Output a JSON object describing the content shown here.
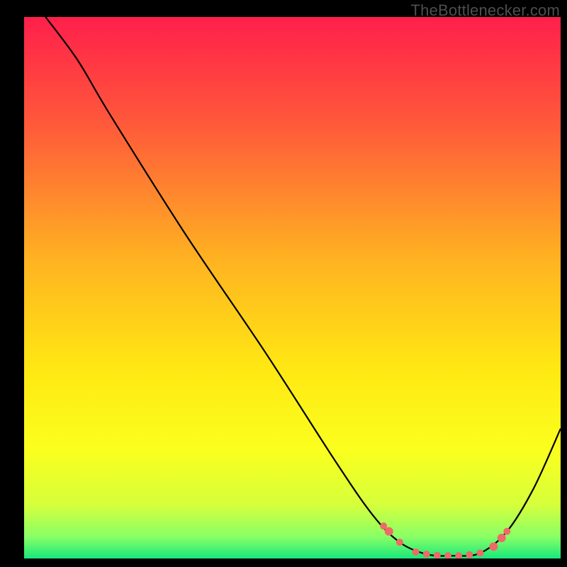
{
  "watermark": "TheBottlenecker.com",
  "chart_data": {
    "type": "line",
    "title": "",
    "xlabel": "",
    "ylabel": "",
    "xlim": [
      0,
      100
    ],
    "ylim": [
      0,
      100
    ],
    "background_gradient": {
      "stops": [
        {
          "pct": 0,
          "color": "#ff1f4b"
        },
        {
          "pct": 20,
          "color": "#ff5a3a"
        },
        {
          "pct": 45,
          "color": "#ffb321"
        },
        {
          "pct": 65,
          "color": "#ffe813"
        },
        {
          "pct": 80,
          "color": "#fbff1e"
        },
        {
          "pct": 90,
          "color": "#d6ff3b"
        },
        {
          "pct": 96,
          "color": "#89ff66"
        },
        {
          "pct": 100,
          "color": "#17e87b"
        }
      ]
    },
    "curve": {
      "stroke": "#000000",
      "stroke_width": 2.2,
      "points": [
        {
          "x": 4,
          "y": 100
        },
        {
          "x": 10,
          "y": 92
        },
        {
          "x": 16,
          "y": 82
        },
        {
          "x": 30,
          "y": 60
        },
        {
          "x": 45,
          "y": 38
        },
        {
          "x": 58,
          "y": 18
        },
        {
          "x": 65,
          "y": 8
        },
        {
          "x": 70,
          "y": 3
        },
        {
          "x": 75,
          "y": 0.8
        },
        {
          "x": 80,
          "y": 0.5
        },
        {
          "x": 85,
          "y": 1
        },
        {
          "x": 90,
          "y": 5
        },
        {
          "x": 95,
          "y": 13
        },
        {
          "x": 100,
          "y": 24
        }
      ]
    },
    "markers": {
      "color": "#ee6a66",
      "points": [
        {
          "x": 67,
          "y": 6.0,
          "r": 5
        },
        {
          "x": 68,
          "y": 5.0,
          "r": 6
        },
        {
          "x": 70,
          "y": 3.0,
          "r": 5
        },
        {
          "x": 73,
          "y": 1.2,
          "r": 5
        },
        {
          "x": 75,
          "y": 0.8,
          "r": 5
        },
        {
          "x": 77,
          "y": 0.6,
          "r": 5
        },
        {
          "x": 79,
          "y": 0.5,
          "r": 5
        },
        {
          "x": 81,
          "y": 0.5,
          "r": 5
        },
        {
          "x": 83,
          "y": 0.7,
          "r": 5
        },
        {
          "x": 85,
          "y": 1.0,
          "r": 5
        },
        {
          "x": 87.5,
          "y": 2.2,
          "r": 6
        },
        {
          "x": 89,
          "y": 3.8,
          "r": 6
        },
        {
          "x": 90,
          "y": 5.0,
          "r": 5
        }
      ]
    }
  }
}
